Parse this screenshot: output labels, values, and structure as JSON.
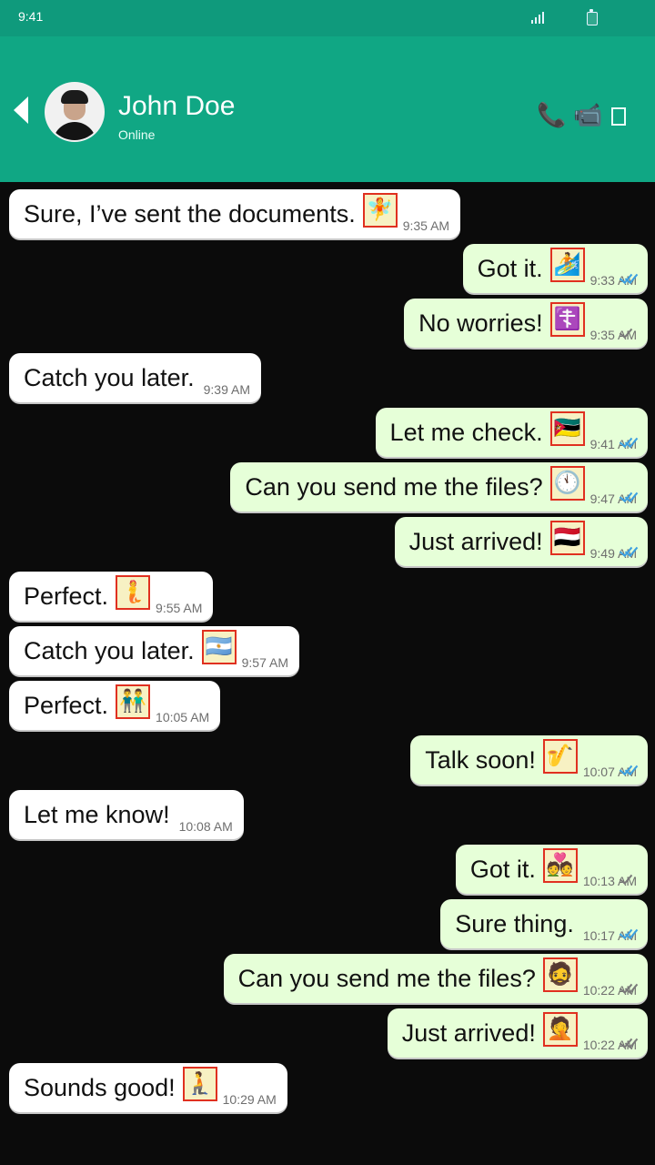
{
  "status_bar": {
    "time": "9:41",
    "signal_icon": "signal-icon",
    "battery_icon": "battery-icon"
  },
  "header": {
    "contact_name": "John Doe",
    "contact_status": "Online",
    "actions": {
      "call_icon": "📞",
      "video_icon": "📹",
      "menu_icon": "square-icon"
    }
  },
  "colors": {
    "header": "#10a784",
    "status_bar": "#0f9a7c",
    "sent_bubble": "#e6ffd8",
    "received_bubble": "#ffffff",
    "read_tick": "#3b9fe0"
  },
  "messages": [
    {
      "dir": "received",
      "text": "Sure, I’ve sent the documents.",
      "emoji": "🧚",
      "time": "9:35 AM"
    },
    {
      "dir": "sent",
      "text": "Got it.",
      "emoji": "🏄",
      "time": "9:33 AM",
      "status": "read"
    },
    {
      "dir": "sent",
      "text": "No worries!",
      "emoji": "☦️",
      "time": "9:35 AM",
      "status": "sent"
    },
    {
      "dir": "received",
      "text": "Catch you later.",
      "emoji": "",
      "time": "9:39 AM"
    },
    {
      "dir": "sent",
      "text": "Let me check.",
      "emoji": "🇲🇿",
      "time": "9:41 AM",
      "status": "read"
    },
    {
      "dir": "sent",
      "text": "Can you send me the files?",
      "emoji": "🕚",
      "time": "9:47 AM",
      "status": "read"
    },
    {
      "dir": "sent",
      "text": "Just arrived!",
      "emoji": "🇾🇪",
      "time": "9:49 AM",
      "status": "read"
    },
    {
      "dir": "received",
      "text": "Perfect.",
      "emoji": "🧜",
      "time": "9:55 AM"
    },
    {
      "dir": "received",
      "text": "Catch you later.",
      "emoji": "🇦🇷",
      "time": "9:57 AM"
    },
    {
      "dir": "received",
      "text": "Perfect.",
      "emoji": "👬",
      "time": "10:05 AM"
    },
    {
      "dir": "sent",
      "text": "Talk soon!",
      "emoji": "🎷",
      "time": "10:07 AM",
      "status": "read"
    },
    {
      "dir": "received",
      "text": "Let me know!",
      "emoji": "",
      "time": "10:08 AM"
    },
    {
      "dir": "sent",
      "text": "Got it.",
      "emoji": "💑",
      "time": "10:13 AM",
      "status": "sent"
    },
    {
      "dir": "sent",
      "text": "Sure thing.",
      "emoji": "",
      "time": "10:17 AM",
      "status": "read"
    },
    {
      "dir": "sent",
      "text": "Can you send me the files?",
      "emoji": "🧔",
      "time": "10:22 AM",
      "status": "delivered"
    },
    {
      "dir": "sent",
      "text": "Just arrived!",
      "emoji": "🤦",
      "time": "10:22 AM",
      "status": "delivered"
    },
    {
      "dir": "received",
      "text": "Sounds good!",
      "emoji": "🧎",
      "time": "10:29 AM"
    }
  ]
}
